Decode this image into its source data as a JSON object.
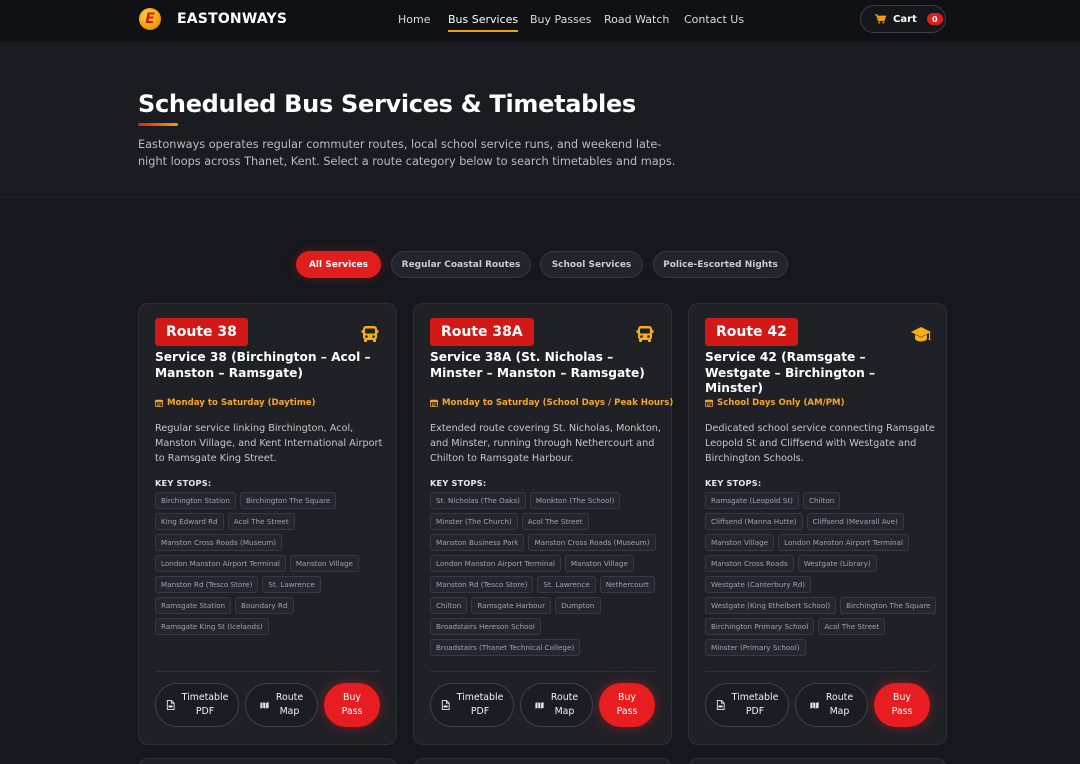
{
  "brand": {
    "logo_letter": "E",
    "name": "EASTONWAYS"
  },
  "nav": {
    "items": [
      {
        "label": "Home"
      },
      {
        "label": "Bus Services"
      },
      {
        "label": "Buy Passes"
      },
      {
        "label": "Road Watch"
      },
      {
        "label": "Contact Us"
      }
    ],
    "active": "Bus Services"
  },
  "cart": {
    "label": "Cart",
    "count": "0"
  },
  "hero": {
    "title": "Scheduled Bus Services & Timetables",
    "description": "Eastonways operates regular commuter routes, local school service runs, and weekend late-night loops across Thanet, Kent. Select a route category below to search timetables and maps."
  },
  "filters": [
    {
      "label": "All Services"
    },
    {
      "label": "Regular Coastal Routes"
    },
    {
      "label": "School Services"
    },
    {
      "label": "Police-Escorted Nights"
    }
  ],
  "active_filter": "All Services",
  "key_stops_label": "KEY STOPS:",
  "buttons": {
    "timetable_1": "Timetable",
    "timetable_2": "PDF",
    "map_1": "Route",
    "map_2": "Map",
    "buy_1": "Buy",
    "buy_2": "Pass"
  },
  "cards": [
    {
      "route": "Route 38",
      "icon": "bus-icon",
      "title": "Service 38 (Birchington – Acol – Manston – Ramsgate)",
      "schedule": "Monday to Saturday (Daytime)",
      "description": "Regular service linking Birchington, Acol, Manston Village, and Kent International Airport to Ramsgate King Street.",
      "stops": [
        "Birchington Station",
        "Birchington The Square",
        "King Edward Rd",
        "Acol The Street",
        "Manston Cross Roads (Museum)",
        "London Manston Airport Terminal",
        "Manston Village",
        "Manston Rd (Tesco Store)",
        "St. Lawrence",
        "Ramsgate Station",
        "Boundary Rd",
        "Ramsgate King St (Icelands)"
      ]
    },
    {
      "route": "Route 38A",
      "icon": "bus-icon",
      "title": "Service 38A (St. Nicholas – Minster – Manston – Ramsgate)",
      "schedule": "Monday to Saturday (School Days / Peak Hours)",
      "description": "Extended route covering St. Nicholas, Monkton, and Minster, running through Nethercourt and Chilton to Ramsgate Harbour.",
      "stops": [
        "St. Nicholas (The Oaks)",
        "Monkton (The School)",
        "Minster (The Church)",
        "Acol The Street",
        "Manston Business Park",
        "Manston Cross Roads (Museum)",
        "London Manston Airport Terminal",
        "Manston Village",
        "Manston Rd (Tesco Store)",
        "St. Lawrence",
        "Nethercourt",
        "Chilton",
        "Ramsgate Harbour",
        "Dumpton",
        "Broadstairs Hereson School",
        "Broadstairs (Thanet Technical College)"
      ]
    },
    {
      "route": "Route 42",
      "icon": "graduation-cap-icon",
      "title": "Service 42 (Ramsgate – Westgate – Birchington – Minster)",
      "schedule": "School Days Only (AM/PM)",
      "description": "Dedicated school service connecting Ramsgate Leopold St and Cliffsend with Westgate and Birchington Schools.",
      "stops": [
        "Ramsgate (Leopold St)",
        "Chilton",
        "Cliffsend (Manna Hutte)",
        "Cliffsend (Mevarall Ave)",
        "Manston Village",
        "London Manston Airport Terminal",
        "Manston Cross Roads",
        "Westgate (Library)",
        "Westgate (Canterbury Rd)",
        "Westgate (King Ethelbert School)",
        "Birchington The Square",
        "Birchington Primary School",
        "Acol The Street",
        "Minster (Primary School)"
      ]
    }
  ],
  "colors": {
    "accent_red": "#e11d1d",
    "accent_amber": "#f59e0b",
    "background": "#16181d",
    "card": "#1f2127"
  }
}
